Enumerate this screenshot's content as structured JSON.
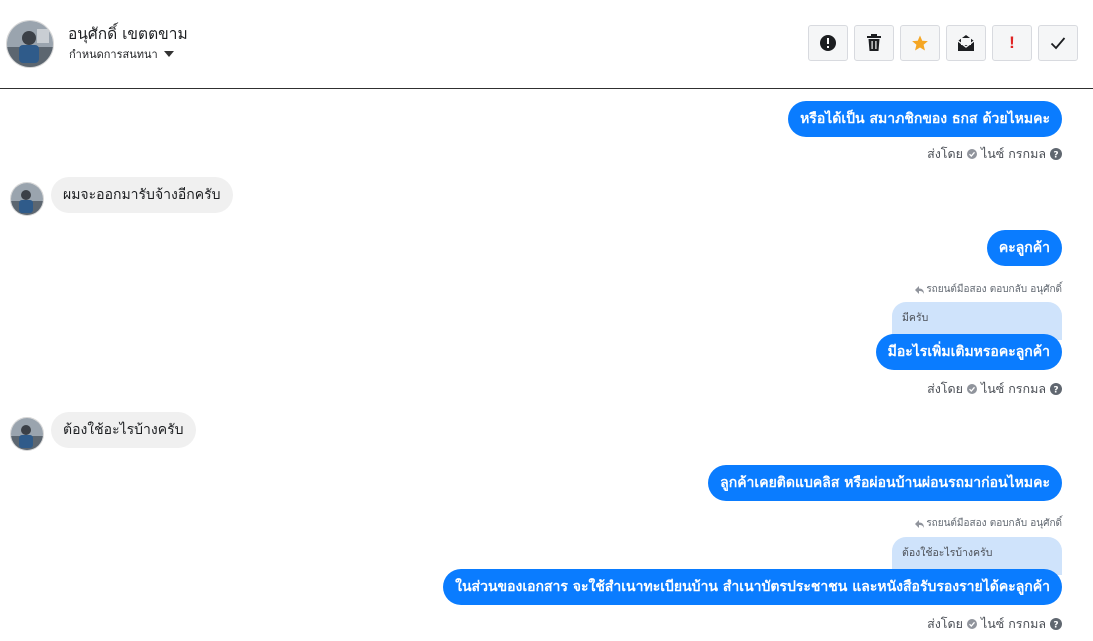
{
  "header": {
    "contact_name": "อนุศักดิ์ เขตตขาม",
    "subtitle": "กำหนดการสนทนา",
    "tools": [
      {
        "name": "mark-spam-button",
        "icon": "alert-circle-icon"
      },
      {
        "name": "delete-button",
        "icon": "trash-icon"
      },
      {
        "name": "star-button",
        "icon": "star-icon"
      },
      {
        "name": "mark-unread-button",
        "icon": "envelope-icon"
      },
      {
        "name": "priority-button",
        "icon": "exclamation-icon",
        "text": "!"
      },
      {
        "name": "done-button",
        "icon": "checkmark-icon"
      }
    ]
  },
  "messages": [
    {
      "direction": "out",
      "text": "หรือได้เป็น สมาภชิกของ ธกส ด้วยไหมคะ"
    },
    {
      "meta": "sent",
      "label": "ส่งโดย",
      "sender": "ไนซ์ กรกมล"
    },
    {
      "direction": "in",
      "text": "ผมจะออกมารับจ้างอีกครับ"
    },
    {
      "direction": "out",
      "text": "คะลูกค้า"
    },
    {
      "reply_hint": "รถยนต์มือสอง ตอบกลับ อนุศักดิ์",
      "quote": "มีครับ"
    },
    {
      "direction": "out",
      "text": "มีอะไรเพิ่มเติมหรอคะลูกค้า"
    },
    {
      "meta": "sent",
      "label": "ส่งโดย",
      "sender": "ไนซ์ กรกมล"
    },
    {
      "direction": "in",
      "text": "ต้องใช้อะไรบ้างครับ"
    },
    {
      "direction": "out",
      "text": "ลูกค้าเคยติดแบคลิส  หรือผ่อนบ้านผ่อนรถมาก่อนไหมคะ"
    },
    {
      "reply_hint": "รถยนต์มือสอง ตอบกลับ อนุศักดิ์",
      "quote": "ต้องใช้อะไรบ้างครับ"
    },
    {
      "direction": "out",
      "text": "ในส่วนของเอกสาร จะใช้สำเนาทะเบียนบ้าน สำเนาบัตรประชาชน และหนังสือรับรองรายได้คะลูกค้า"
    },
    {
      "meta": "sent",
      "label": "ส่งโดย",
      "sender": "ไนซ์ กรกมล"
    }
  ],
  "colors": {
    "outgoing_bubble": "#0a7cff",
    "incoming_bubble": "#f0f0f0",
    "quote_bubble": "#cfe3fb",
    "star": "#f5a623",
    "priority": "#e02424"
  }
}
